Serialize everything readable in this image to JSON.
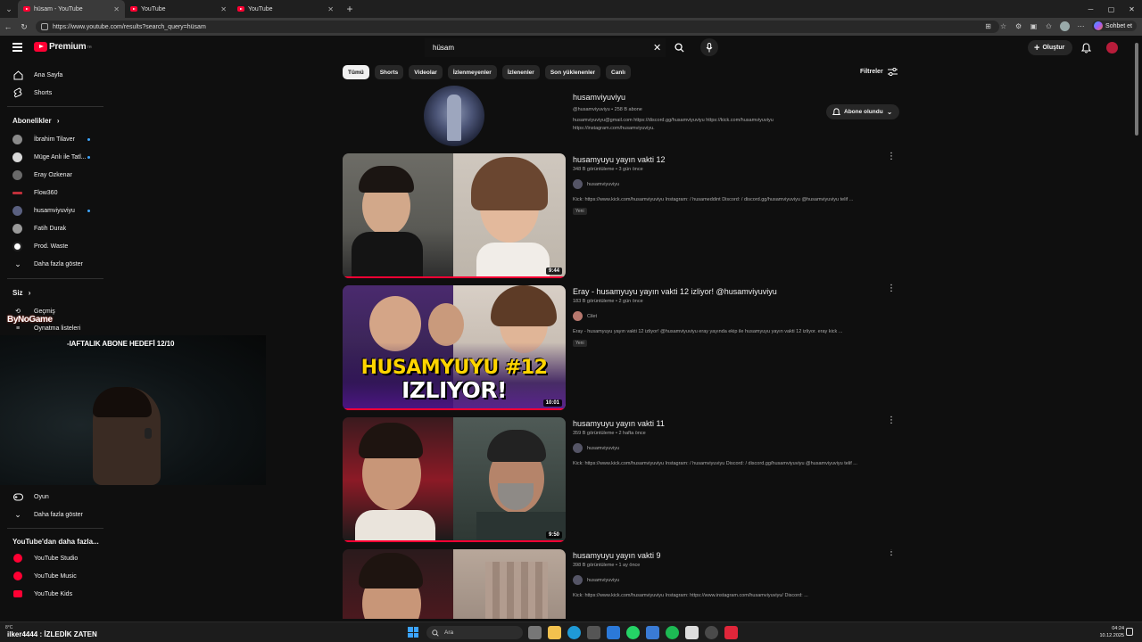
{
  "browser": {
    "tabs": [
      {
        "label": "hüsam - YouTube",
        "active": true
      },
      {
        "label": "YouTube",
        "active": false
      },
      {
        "label": "YouTube",
        "active": false
      }
    ],
    "url": "https://www.youtube.com/results?search_query=hüsam",
    "copilot_label": "Sohbet et"
  },
  "masthead": {
    "logo_text": "Premium",
    "logo_sup": "TR",
    "search_value": "hüsam",
    "create_label": "Oluştur"
  },
  "sidebar": {
    "main": [
      {
        "label": "Ana Sayfa",
        "icon": "home-icon"
      },
      {
        "label": "Shorts",
        "icon": "shorts-icon"
      }
    ],
    "subscriptions_header": "Abonelikler",
    "subscriptions": [
      {
        "label": "İbrahim Tilaver",
        "dot": true,
        "color": "#8a8a8a"
      },
      {
        "label": "Müge Anlı ile Tatl...",
        "dot": true,
        "color": "#d8d8d8"
      },
      {
        "label": "Eray Ozkenar",
        "dot": false,
        "color": "#6a6a6a"
      },
      {
        "label": "Flow360",
        "dot": false,
        "color": "#c0303a"
      },
      {
        "label": "husamviyuviyu",
        "dot": true,
        "color": "#5a6080"
      },
      {
        "label": "Fatih Durak",
        "dot": false,
        "color": "#9a9a9a"
      },
      {
        "label": "Prod. Waste",
        "dot": false,
        "color": "#ffffff"
      }
    ],
    "show_more": "Daha fazla göster",
    "you_header": "Siz",
    "you_items": [
      "Geçmiş",
      "Oynatma listeleri"
    ],
    "explore_items": [
      {
        "label": "Oyun",
        "icon": "gamepad-icon"
      }
    ],
    "show_more_2": "Daha fazla göster",
    "more_from_header": "YouTube'dan daha fazla...",
    "more_from": [
      "YouTube Studio",
      "YouTube Music",
      "YouTube Kids"
    ]
  },
  "overlay": {
    "brand": "ByNoGame",
    "goal_text": "-IAFTALIK ABONE HEDEFİ 12/10"
  },
  "chips": [
    "Tümü",
    "Shorts",
    "Videolar",
    "İzlenmeyenler",
    "İzlenenler",
    "Son yüklenenler",
    "Canlı"
  ],
  "filters_label": "Filtreler",
  "channel": {
    "name": "husamviyuviyu",
    "meta": "@husamviyuviyu • 258 B abone",
    "description": "husamviyuviyu@gmail.com https://discord.gg/husamviyuviyu https://kick.com/husamviyuviyu https://instagram.com/husamviyuviyu.",
    "subscribe_label": "Abone olundu"
  },
  "videos": [
    {
      "title": "husamyuyu yayın vakti 12",
      "meta": "348 B görüntüleme • 3 gün önce",
      "channel": "husamviyuviyu",
      "description": "Kick: https://www.kick.com/husamviyuviyu Instagram: / husameddint Discord: / discord.gg/husamviyuviyu @husamviyuviyu telif ...",
      "badge": "Yeni",
      "duration": "9:44",
      "overlay": "",
      "progress": 1.0
    },
    {
      "title": "Eray - husamyuyu yayın vakti 12 izliyor! @husamviyuviyu",
      "meta": "183 B görüntüleme • 2 gün önce",
      "channel": "Cilet",
      "description": "Eray - husamyuyu yayın vakti 12 izliyor! @husamviyuviyu eray yayında ekip ile husamyuyu yayın vakti 12 izliyor. eray kick ...",
      "badge": "Yeni",
      "duration": "10:01",
      "overlay": "HUSAMYUYU #12",
      "overlay2": "IZLIYOR!",
      "progress": 1.0
    },
    {
      "title": "husamyuyu yayın vakti 11",
      "meta": "359 B görüntüleme • 2 hafta önce",
      "channel": "husamviyuviyu",
      "description": "Kick: https://www.kick.com/husamviyuviyu Instagram: / husamviyuviyu Discord: / discord.gg/husamviyuviyu @husamviyuviyu telif ...",
      "badge": "",
      "duration": "9:50",
      "overlay": "",
      "progress": 1.0
    },
    {
      "title": "husamyuyu yayın vakti 9",
      "meta": "398 B görüntüleme • 1 ay önce",
      "channel": "husamviyuviyu",
      "description": "Kick: https://www.kick.com/husamviyuviyu Instagram: https://www.instagram.com/husamviyuviyu/ Discord: ...",
      "badge": "",
      "duration": "",
      "overlay": "",
      "progress": 0
    }
  ],
  "taskbar": {
    "weather": "8°C",
    "ticker": "ilker4444 : İZLEDİK ZATEN",
    "search_label": "Ara",
    "time": "04:24",
    "date": "10.12.2025"
  }
}
